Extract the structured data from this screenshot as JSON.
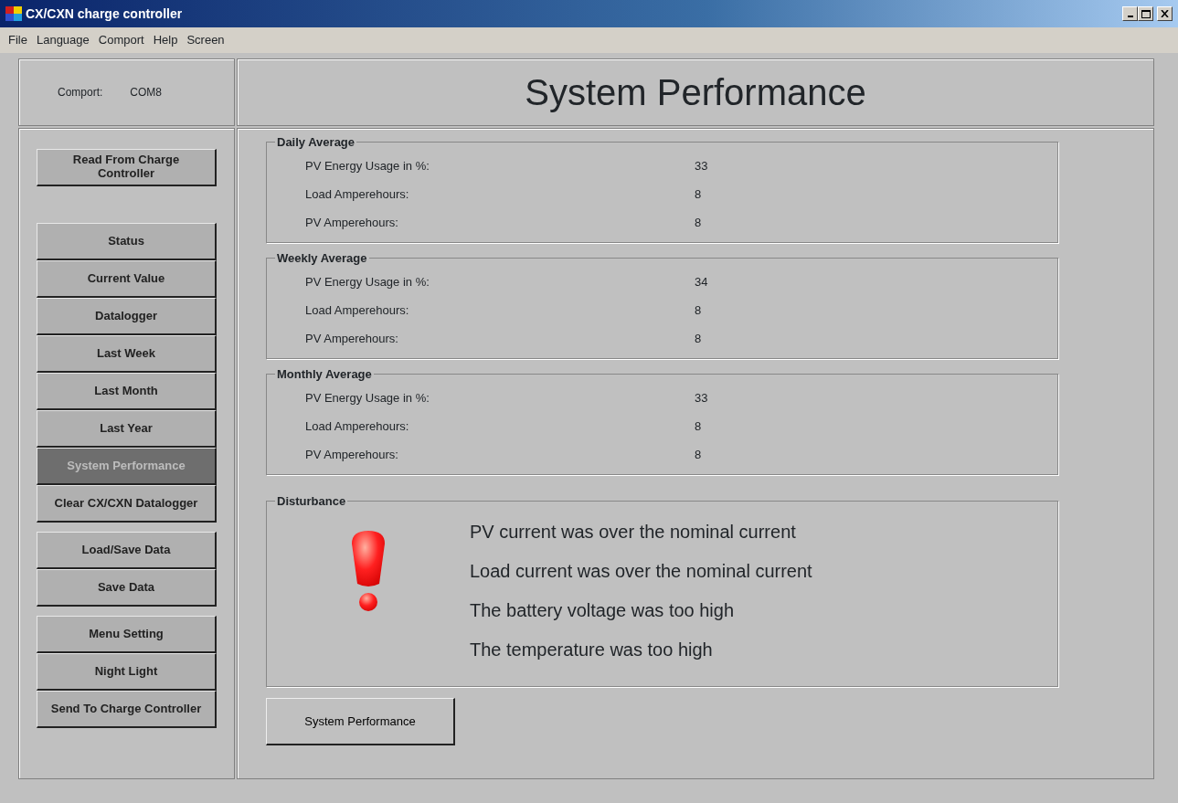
{
  "window": {
    "title": "CX/CXN charge controller"
  },
  "menu": [
    "File",
    "Language",
    "Comport",
    "Help",
    "Screen"
  ],
  "comport": {
    "label": "Comport:",
    "value": "COM8"
  },
  "sidebar": {
    "groups": [
      [
        {
          "label": "Read From Charge Controller",
          "selected": false
        }
      ],
      [
        {
          "label": "Status",
          "selected": false
        },
        {
          "label": "Current Value",
          "selected": false
        },
        {
          "label": "Datalogger",
          "selected": false
        },
        {
          "label": "Last Week",
          "selected": false
        },
        {
          "label": "Last Month",
          "selected": false
        },
        {
          "label": "Last Year",
          "selected": false
        },
        {
          "label": "System Performance",
          "selected": true
        },
        {
          "label": "Clear CX/CXN Datalogger",
          "selected": false
        }
      ],
      [
        {
          "label": "Load/Save Data",
          "selected": false
        },
        {
          "label": "Save Data",
          "selected": false
        }
      ],
      [
        {
          "label": "Menu Setting",
          "selected": false
        },
        {
          "label": "Night Light",
          "selected": false
        },
        {
          "label": "Send To Charge Controller",
          "selected": false
        }
      ]
    ]
  },
  "page_title": "System Performance",
  "sections": [
    {
      "title": "Daily Average",
      "rows": [
        {
          "label": "PV Energy Usage in %:",
          "value": "33"
        },
        {
          "label": "Load Amperehours:",
          "value": "8"
        },
        {
          "label": "PV Amperehours:",
          "value": "8"
        }
      ]
    },
    {
      "title": "Weekly Average",
      "rows": [
        {
          "label": "PV Energy Usage in %:",
          "value": "34"
        },
        {
          "label": "Load Amperehours:",
          "value": "8"
        },
        {
          "label": "PV Amperehours:",
          "value": "8"
        }
      ]
    },
    {
      "title": "Monthly Average",
      "rows": [
        {
          "label": "PV Energy Usage in %:",
          "value": "33"
        },
        {
          "label": "Load Amperehours:",
          "value": "8"
        },
        {
          "label": "PV Amperehours:",
          "value": "8"
        }
      ]
    }
  ],
  "disturbance": {
    "title": "Disturbance",
    "messages": [
      "PV current was over the nominal current",
      "Load current was over the nominal current",
      "The battery voltage was too high",
      "The temperature was too high"
    ]
  },
  "action_button": "System Performance"
}
